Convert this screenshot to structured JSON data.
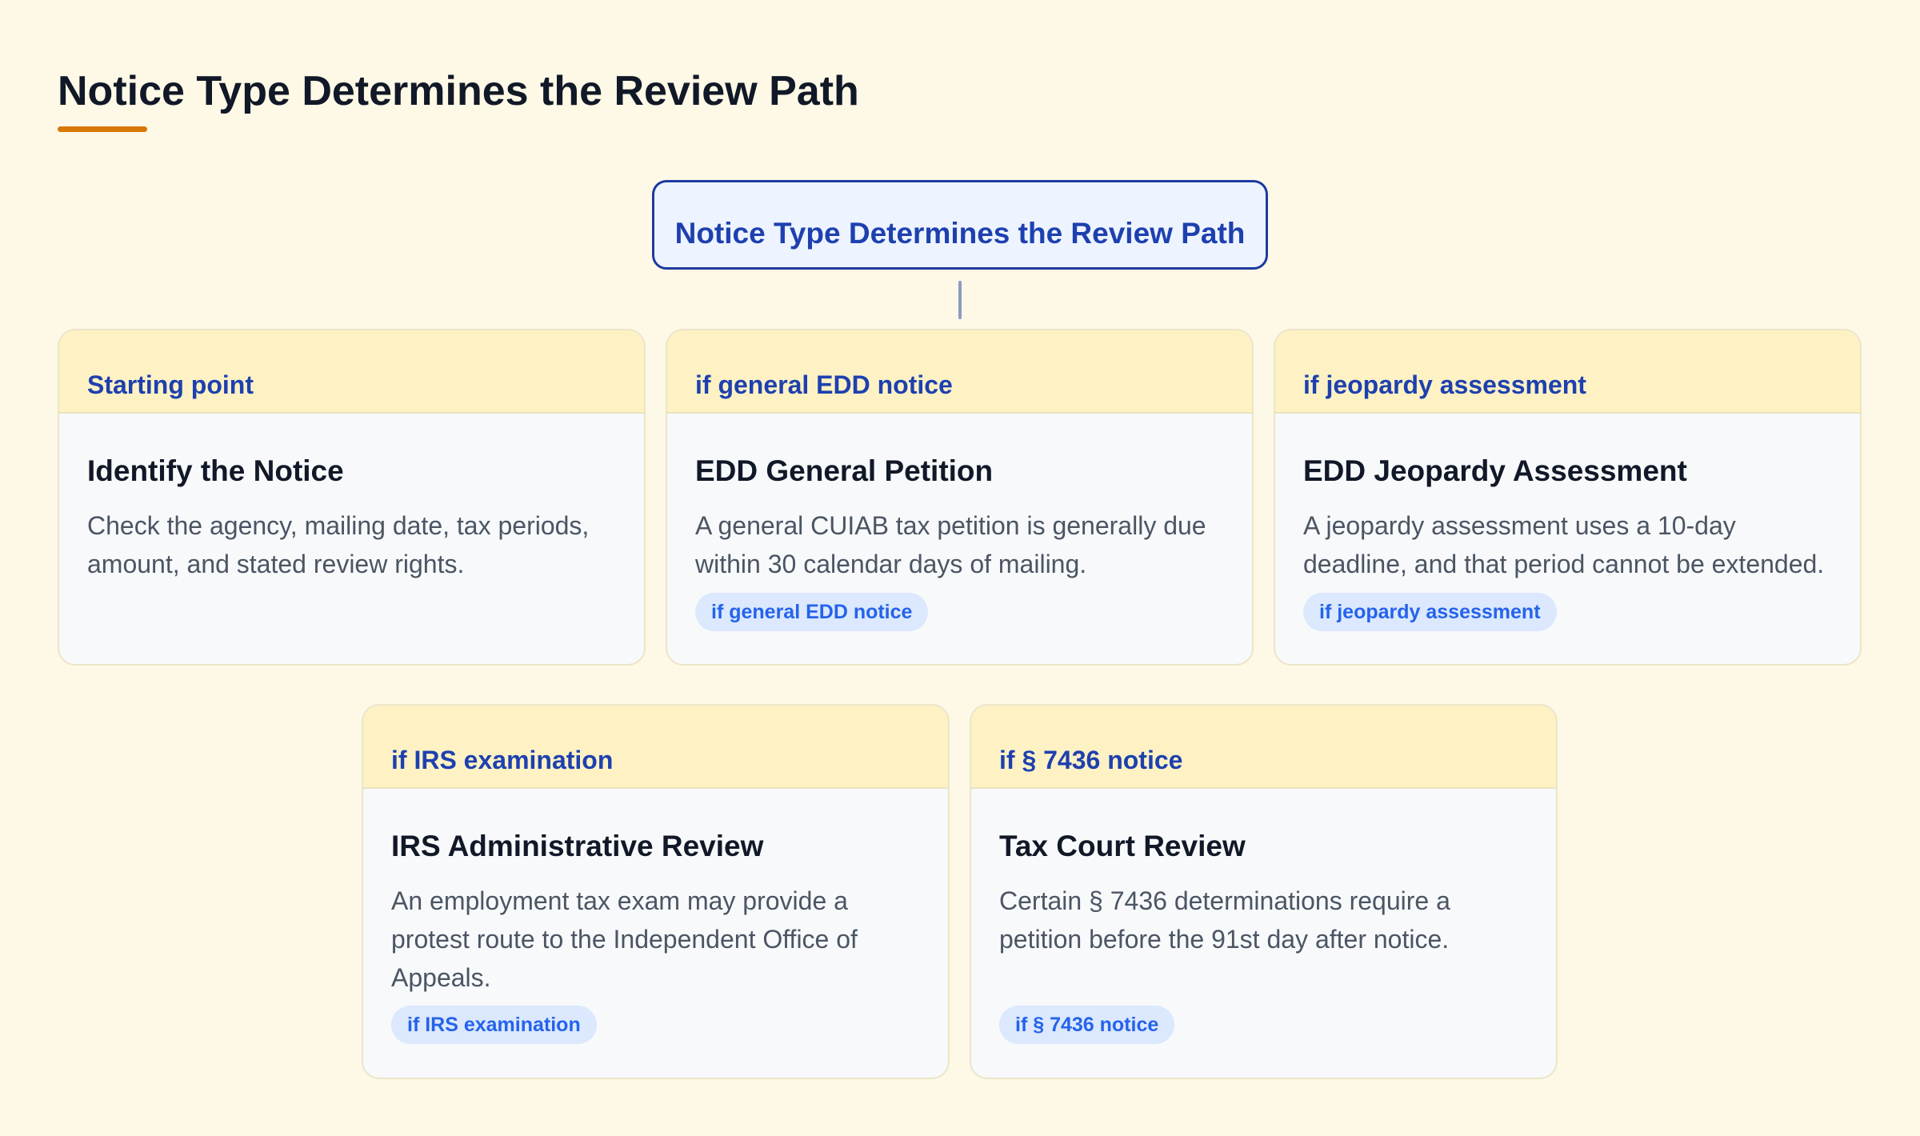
{
  "diagram": {
    "title": "Notice Type Determines the Review Path",
    "root_label": "Notice Type Determines the Review Path",
    "cards": [
      {
        "condition": "Starting point",
        "heading": "Identify the Notice",
        "description": "Check the agency, mailing date, tax periods, amount, and stated review rights.",
        "tag": ""
      },
      {
        "condition": "if general EDD notice",
        "heading": "EDD General Petition",
        "description": "A general CUIAB tax petition is generally due within 30 calendar days of mailing.",
        "tag": "if general EDD notice"
      },
      {
        "condition": "if jeopardy assessment",
        "heading": "EDD Jeopardy Assessment",
        "description": "A jeopardy assessment uses a 10-day deadline, and that period cannot be extended.",
        "tag": "if jeopardy assessment"
      },
      {
        "condition": "if IRS examination",
        "heading": "IRS Administrative Review",
        "description": "An employment tax exam may provide a protest route to the Independent Office of Appeals.",
        "tag": "if IRS examination"
      },
      {
        "condition": "if § 7436 notice",
        "heading": "Tax Court Review",
        "description": "Certain § 7436 determinations require a petition before the 91st day after notice.",
        "tag": "if § 7436 notice"
      }
    ]
  },
  "colors": {
    "background": "#fdf9e6",
    "accent": "#d97706",
    "primary": "#1e40af",
    "card_header": "#fef2c4",
    "tag_background": "#dbe8fd",
    "tag_text": "#2563eb"
  }
}
